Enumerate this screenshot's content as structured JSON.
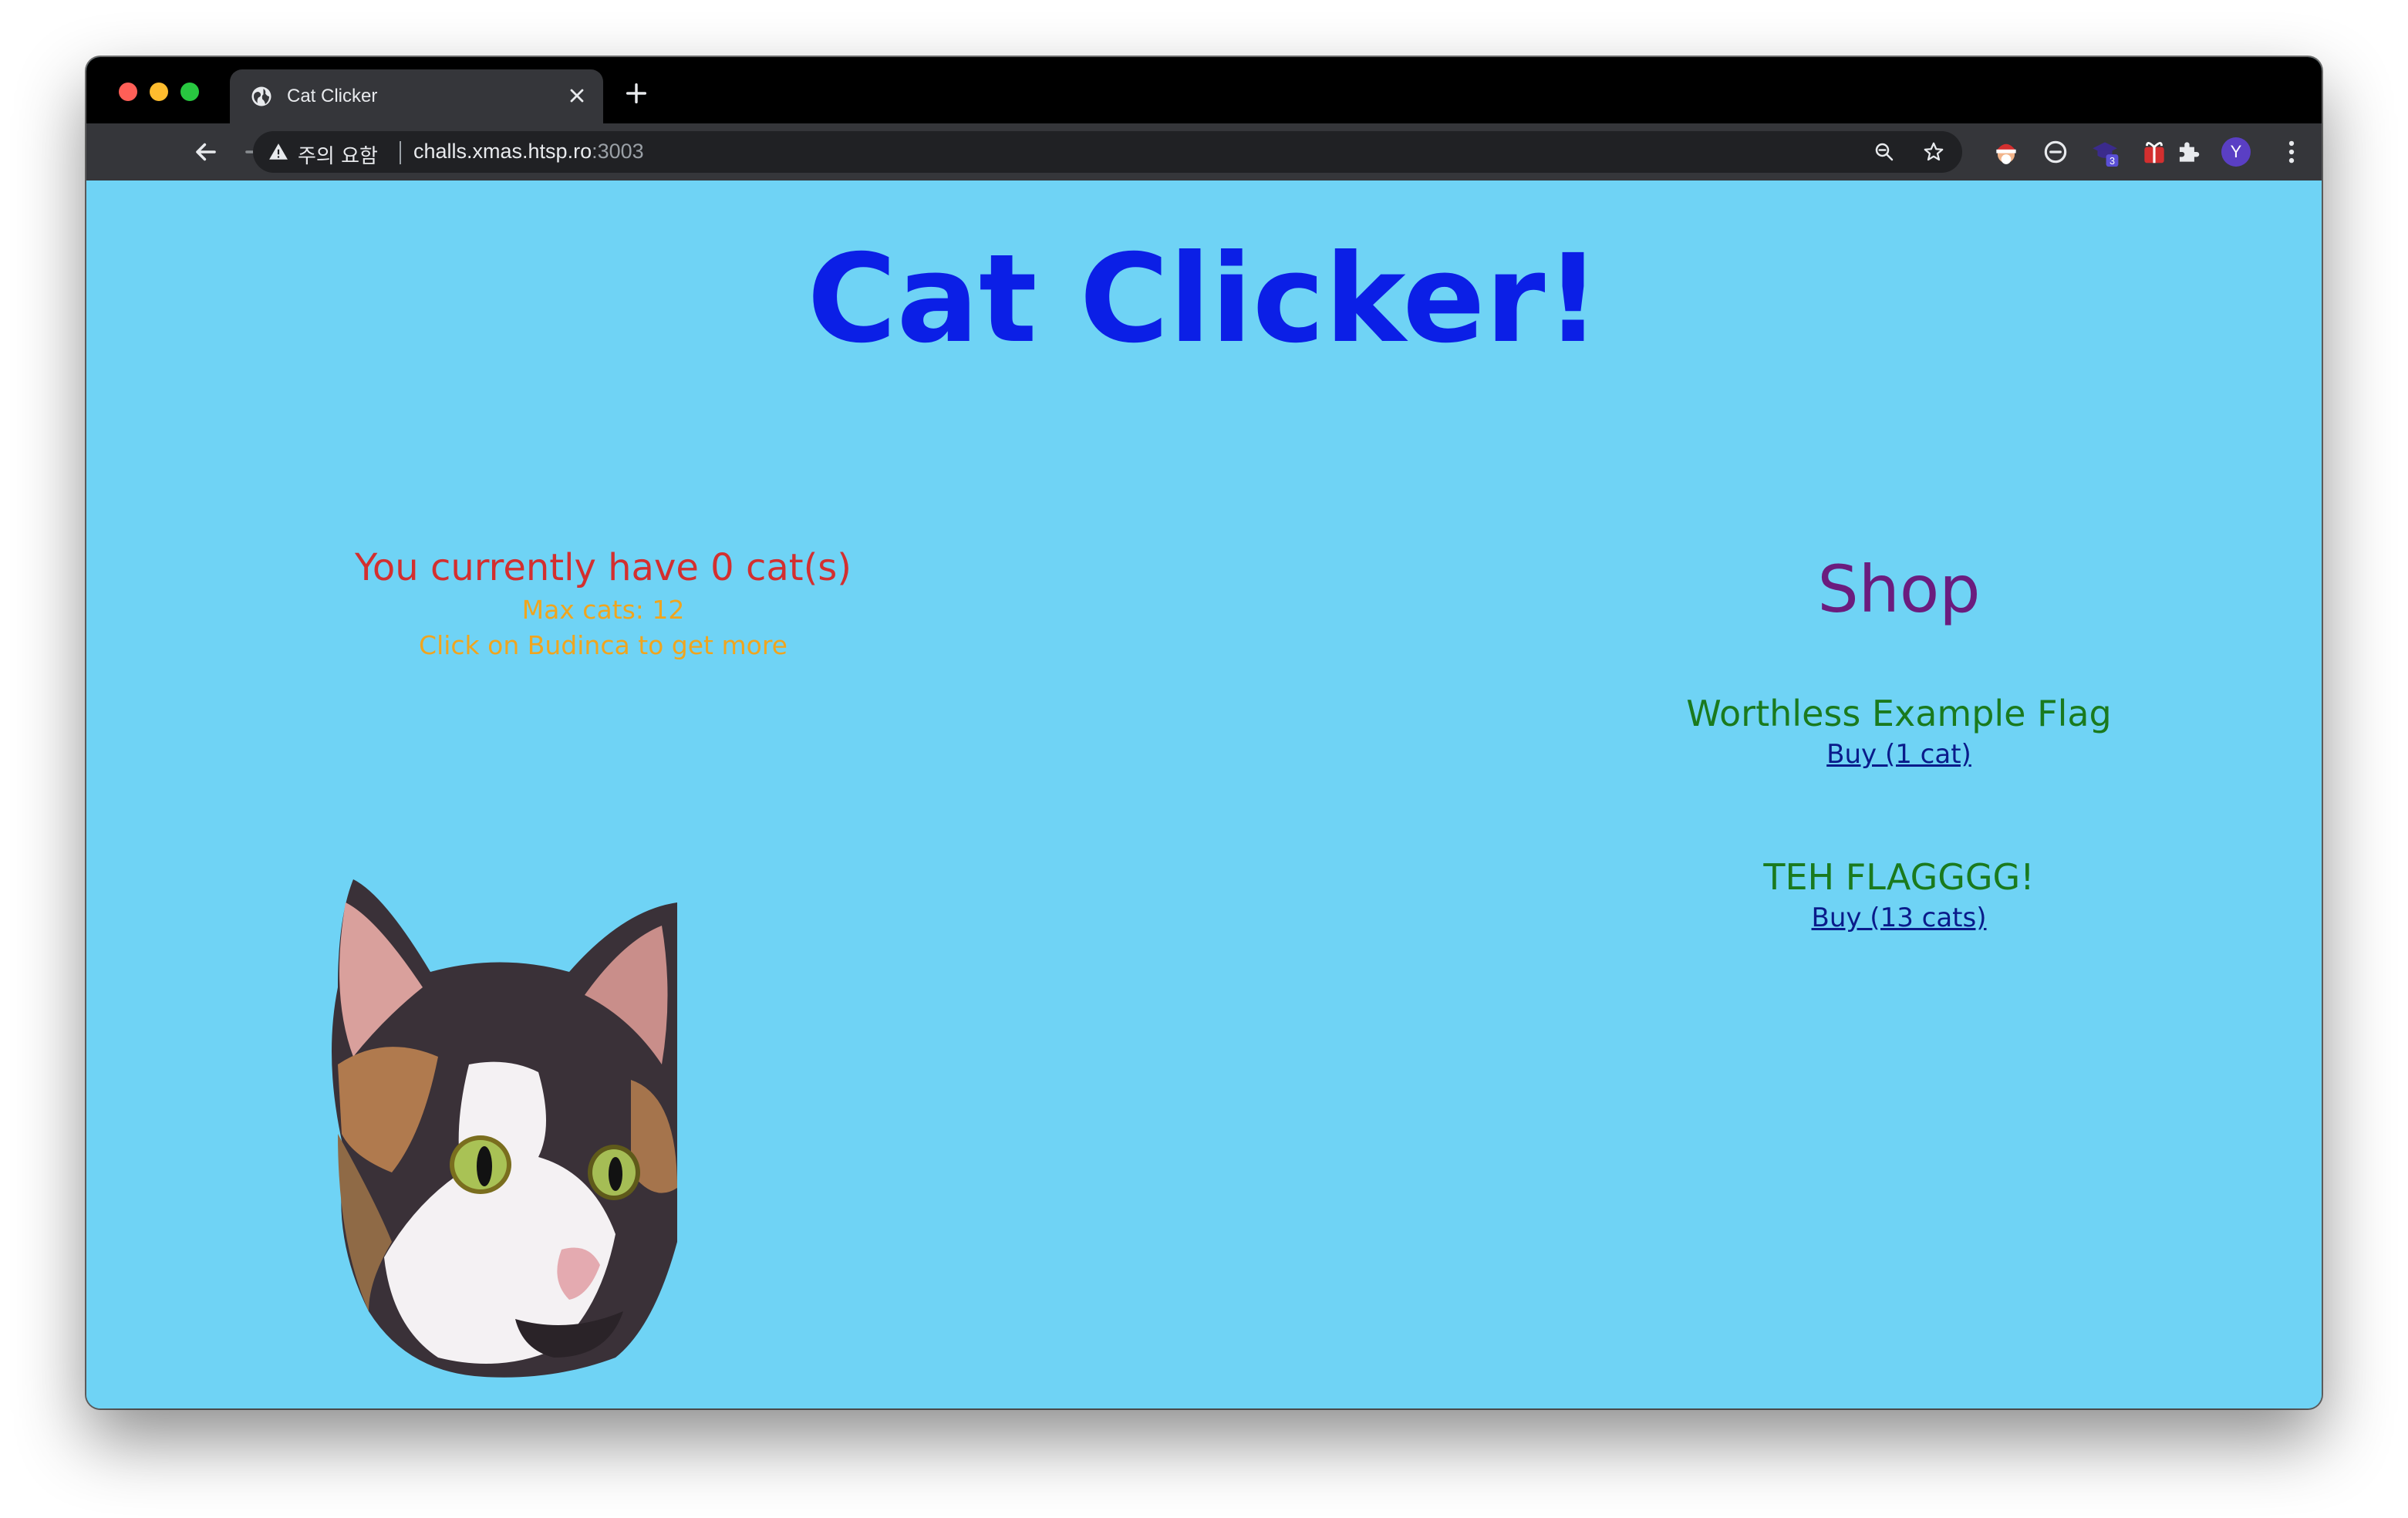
{
  "browser": {
    "tab_title": "Cat Clicker",
    "security_label": "주의 요함",
    "url_host": "challs.xmas.htsp.ro",
    "url_port": ":3003",
    "extension_badge": "3",
    "profile_initial": "Y"
  },
  "page": {
    "title": "Cat Clicker!",
    "cat_count_text": "You currently have 0 cat(s)",
    "max_cats_text": "Max cats: 12",
    "hint_text": "Click on Budinca to get more",
    "cat_image_icon": "calico-cat-head-image"
  },
  "shop": {
    "title": "Shop",
    "items": [
      {
        "name": "Worthless Example Flag",
        "buy_label": "Buy (1 cat)"
      },
      {
        "name": "TEH FLAGGGG!",
        "buy_label": "Buy (13 cats)"
      }
    ]
  },
  "colors": {
    "page_background": "#6fd3f5",
    "title": "#0b1fe6",
    "cat_count": "#d32f2f",
    "info_text": "#f0a51e",
    "shop_title": "#6b1c7e",
    "item_name": "#1a7a1e",
    "buy_link": "#0a1b8a"
  }
}
